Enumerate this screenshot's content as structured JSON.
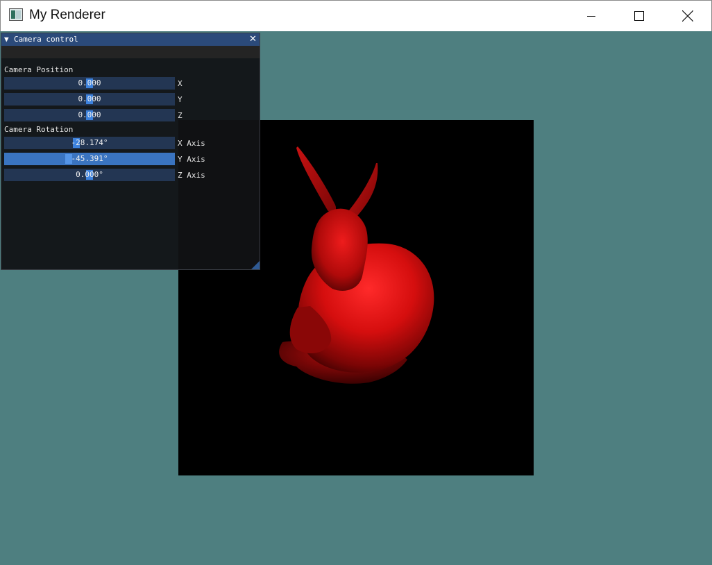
{
  "window": {
    "title": "My Renderer"
  },
  "panel": {
    "title": "Camera control",
    "collapse_glyph": "▼",
    "close_glyph": "✕",
    "position_label": "Camera Position",
    "rotation_label": "Camera Rotation",
    "position_fields": [
      {
        "value": "0.000",
        "label": "X"
      },
      {
        "value": "0.000",
        "label": "Y"
      },
      {
        "value": "0.000",
        "label": "Z"
      }
    ],
    "rotation_fields": [
      {
        "value": "-28.174°",
        "label": "X Axis"
      },
      {
        "value": "-45.391°",
        "label": "Y Axis"
      },
      {
        "value": "0.000°",
        "label": "Z Axis"
      }
    ]
  },
  "colors": {
    "background": "#4e7f80",
    "panel_header": "#2b4a7a",
    "drag_field": "#233653",
    "drag_field_active": "#3a74c0",
    "model": "#e01010"
  },
  "icons": {
    "minimize": "minimize-icon",
    "maximize": "maximize-icon",
    "close": "close-icon",
    "collapse": "triangle-down-icon"
  }
}
